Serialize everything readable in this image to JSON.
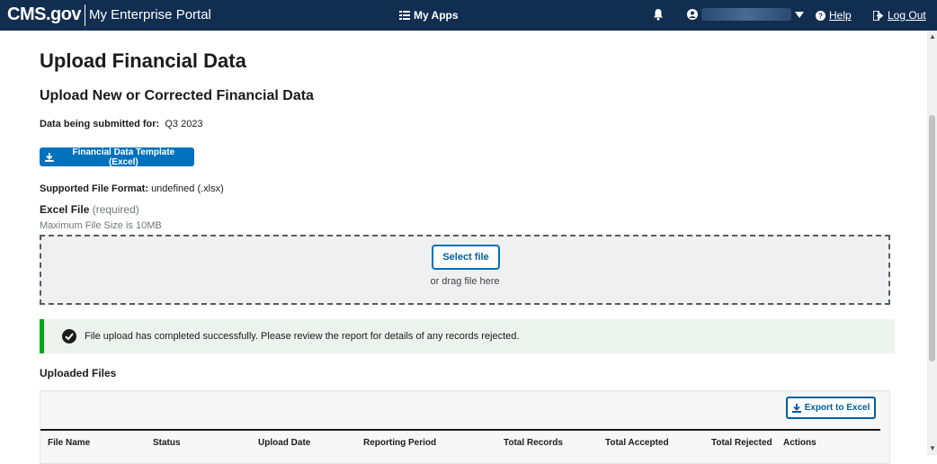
{
  "header": {
    "logo": "CMS.gov",
    "portal_title": "My Enterprise Portal",
    "my_apps": "My Apps",
    "help": "Help",
    "logout": "Log Out"
  },
  "page": {
    "title": "Upload Financial Data",
    "subtitle": "Upload New or Corrected Financial Data",
    "submitted_label": "Data being submitted for:",
    "submitted_value": "Q3 2023",
    "template_button": "Financial Data Template (Excel)",
    "format_label": "Supported File Format:",
    "format_value": "undefined (.xlsx)",
    "excel_label": "Excel File",
    "excel_required": "(required)",
    "max_size": "Maximum File Size is 10MB",
    "select_file": "Select file",
    "drag_text": "or drag file here",
    "alert_text": "File upload has completed successfully. Please review the report for details of any records rejected.",
    "uploaded_title": "Uploaded Files",
    "export_button": "Export to Excel"
  },
  "table": {
    "columns": [
      "File Name",
      "Status",
      "Upload Date",
      "Reporting Period",
      "Total Records",
      "Total Accepted",
      "Total Rejected",
      "Actions"
    ]
  },
  "colors": {
    "nav_bg": "#112e51",
    "primary": "#0071bc",
    "success": "#00a91c",
    "success_bg": "#ecf3ec"
  }
}
